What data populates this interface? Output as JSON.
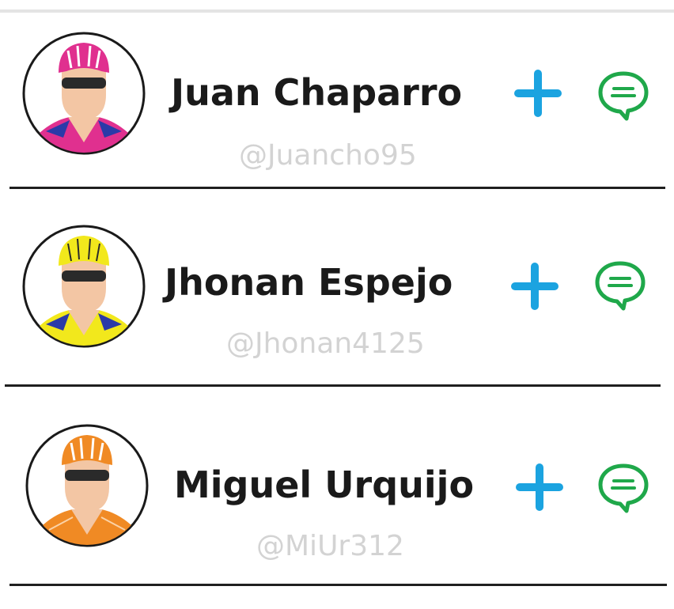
{
  "contacts": [
    {
      "name": "Juan Chaparro",
      "handle": "@Juancho95",
      "helmet_color": "#e0308f",
      "jersey_color": "#e0308f",
      "jersey_stripe": "#2b3aa8",
      "add_icon": "plus-icon",
      "message_icon": "chat-bubble-icon"
    },
    {
      "name": "Jhonan Espejo",
      "handle": "@Jhonan4125",
      "helmet_color": "#f2e81c",
      "jersey_color": "#f2e81c",
      "jersey_stripe": "#2b3aa8",
      "add_icon": "plus-icon",
      "message_icon": "chat-bubble-icon"
    },
    {
      "name": "Miguel Urquijo",
      "handle": "@MiUr312",
      "helmet_color": "#f08a24",
      "jersey_color": "#f08a24",
      "jersey_stripe": "#f08a24",
      "add_icon": "plus-icon",
      "message_icon": "chat-bubble-icon"
    }
  ],
  "colors": {
    "add_accent": "#1ba3e0",
    "message_accent": "#1fa84a",
    "name_text": "#1a1a1a",
    "handle_text": "#d3d3d3",
    "divider": "#1f1f1f",
    "skin": "#f3c6a4"
  }
}
